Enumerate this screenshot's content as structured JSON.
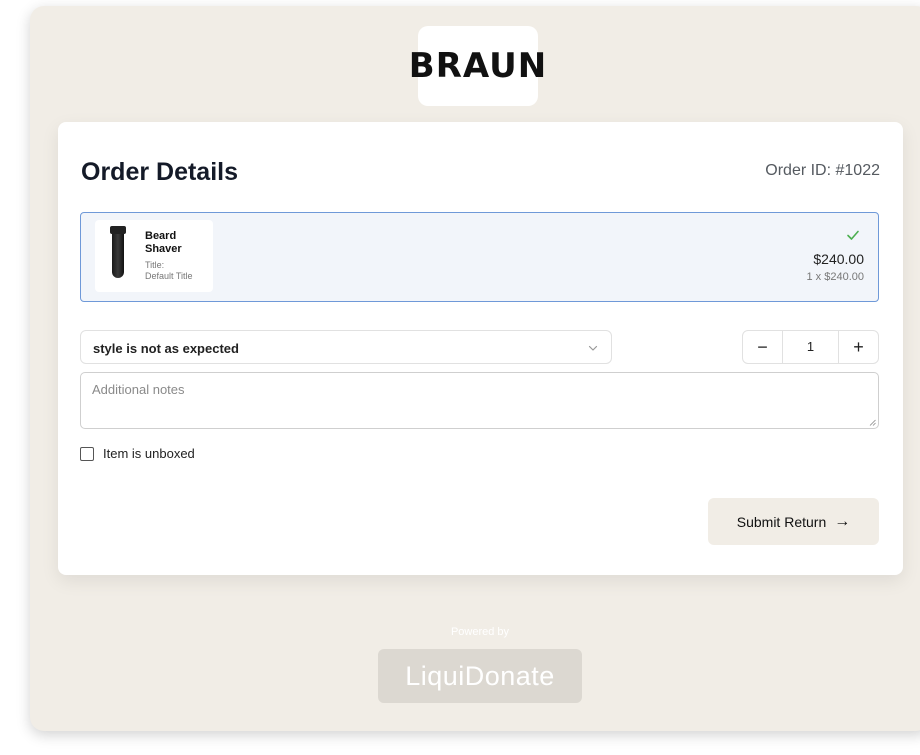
{
  "brand": {
    "logo_text": "BRAUN"
  },
  "order": {
    "title": "Order Details",
    "id_label": "Order ID: #1022"
  },
  "item": {
    "name": "Beard Shaver",
    "title_label": "Title:",
    "title_value": "Default Title",
    "price": "$240.00",
    "qty_price": "1 x $240.00",
    "selected": true,
    "icon": "checkmark-icon",
    "accent_color": "#6f99d8",
    "check_color": "#4caf50"
  },
  "return_form": {
    "reason_selected": "style is not as expected",
    "quantity": "1",
    "minus_label": "−",
    "plus_label": "+",
    "notes_placeholder": "Additional notes",
    "unboxed_label": "Item is unboxed",
    "unboxed_checked": false,
    "submit_label": "Submit Return",
    "submit_arrow": "→"
  },
  "footer": {
    "powered_by": "Powered by",
    "partner_logo_text": "LiquiDonate"
  }
}
